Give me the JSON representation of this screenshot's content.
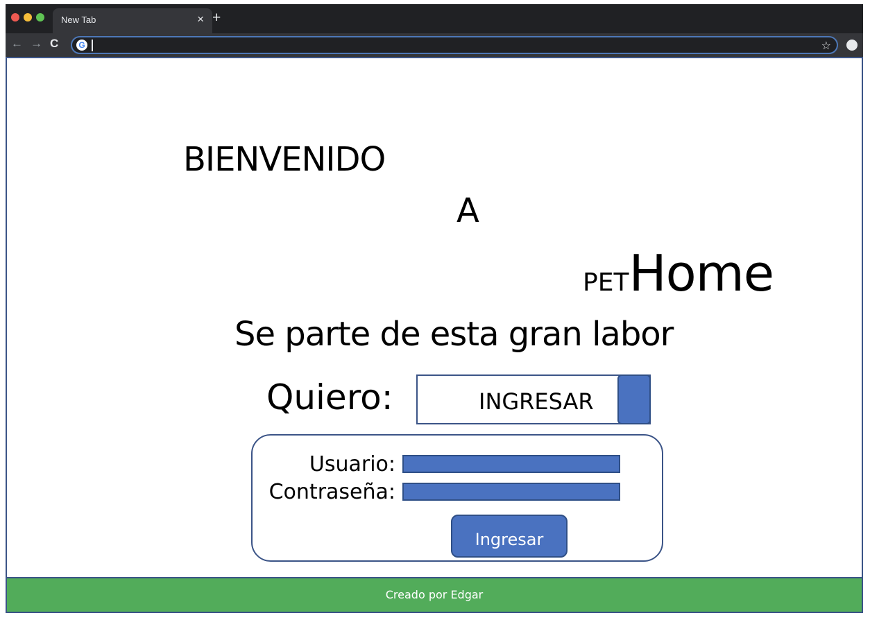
{
  "browser": {
    "tab_title": "New Tab",
    "tab_close": "×",
    "new_tab": "+",
    "icons": {
      "back": "←",
      "forward": "→",
      "reload": "C",
      "google": "G",
      "star": "☆"
    }
  },
  "hero": {
    "line1": "BIENVENIDO",
    "line2": "A",
    "brand_prefix": "PET",
    "brand_main": "Home",
    "slogan": "Se parte de esta gran labor"
  },
  "choice": {
    "label": "Quiero:",
    "selected_value": "INGRESAR"
  },
  "login": {
    "user_label": "Usuario:",
    "password_label": "Contraseña:",
    "submit_label": "Ingresar"
  },
  "footer": {
    "text": "Creado por Edgar"
  },
  "colors": {
    "accent": "#4a72c0",
    "border": "#3b5487",
    "footer_bg": "#52ac5a",
    "chrome_bg": "#202124"
  }
}
